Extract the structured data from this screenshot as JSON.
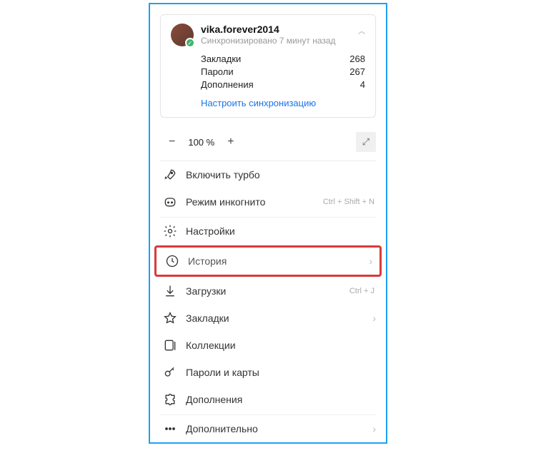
{
  "profile": {
    "username": "vika.forever2014",
    "sync_status": "Синхронизировано 7 минут назад"
  },
  "stats": {
    "bookmarks_label": "Закладки",
    "bookmarks_count": "268",
    "passwords_label": "Пароли",
    "passwords_count": "267",
    "addons_label": "Дополнения",
    "addons_count": "4"
  },
  "sync_link": "Настроить синхронизацию",
  "zoom": {
    "level": "100 %"
  },
  "menu": {
    "turbo": "Включить турбо",
    "incognito": "Режим инкогнито",
    "incognito_hint": "Ctrl + Shift + N",
    "settings": "Настройки",
    "history": "История",
    "downloads": "Загрузки",
    "downloads_hint": "Ctrl + J",
    "bookmarks": "Закладки",
    "collections": "Коллекции",
    "passwords_cards": "Пароли и карты",
    "addons": "Дополнения",
    "more": "Дополнительно"
  }
}
